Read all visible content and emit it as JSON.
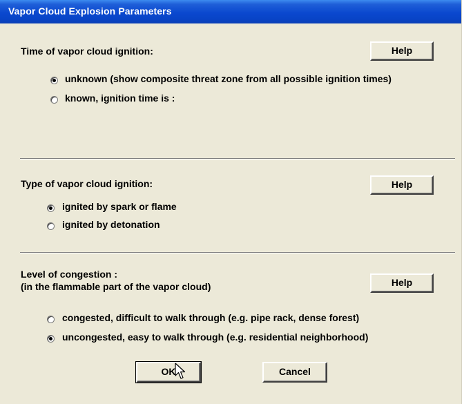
{
  "window": {
    "title": "Vapor Cloud Explosion Parameters"
  },
  "ignition_time": {
    "heading": "Time of vapor cloud ignition:",
    "help": "Help",
    "options": [
      {
        "label": "unknown (show composite threat zone from all possible ignition times)",
        "selected": true
      },
      {
        "label": "known,  ignition time is :",
        "selected": false
      }
    ]
  },
  "ignition_type": {
    "heading": "Type of vapor cloud ignition:",
    "help": "Help",
    "options": [
      {
        "label": "ignited by spark or flame",
        "selected": true
      },
      {
        "label": "ignited by detonation",
        "selected": false
      }
    ]
  },
  "congestion": {
    "heading": "Level of congestion :",
    "subheading": "(in the flammable part of the vapor cloud)",
    "help": "Help",
    "options": [
      {
        "label": "congested, difficult to walk through (e.g. pipe rack, dense forest)",
        "selected": false
      },
      {
        "label": "uncongested, easy to walk through (e.g. residential neighborhood)",
        "selected": true
      }
    ]
  },
  "buttons": {
    "ok": "OK",
    "cancel": "Cancel"
  }
}
